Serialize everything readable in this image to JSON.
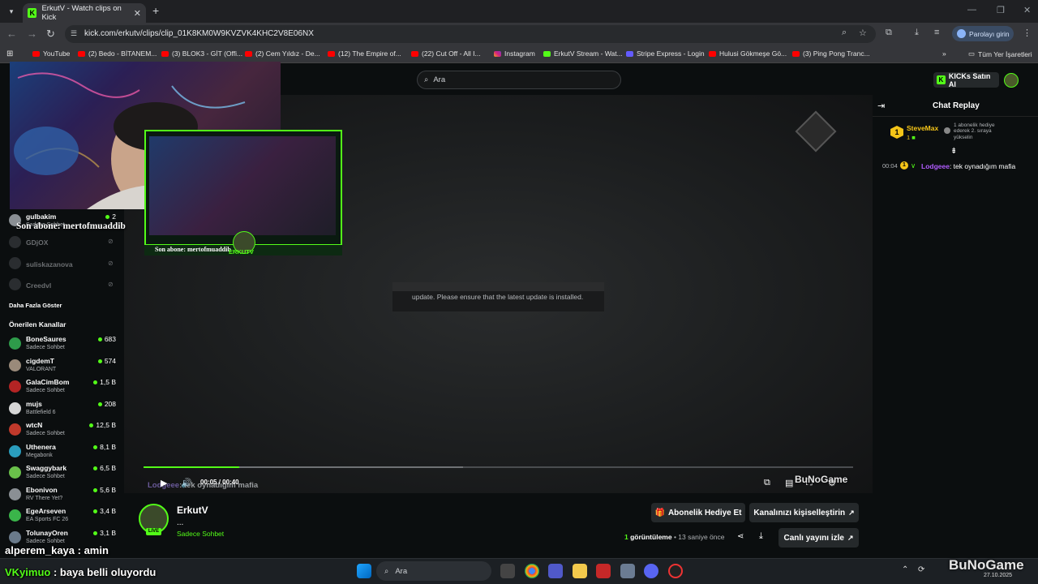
{
  "browser": {
    "tab_title": "ErkutV - Watch clips on Kick",
    "tab_favicon": "K",
    "new_tab": "+",
    "url": "kick.com/erkutv/clips/clip_01K8KM0W9KVZVK4KHC2V8E06NX",
    "signin_label": "Parolayı girin",
    "bookmarks": [
      "YouTube",
      "(2) Bedo - BİTANEM...",
      "(3) BLOK3 - GİT (Offi...",
      "(2) Cem Yıldız - De...",
      "(12) The Empire of...",
      "(22) Cut Off - All I...",
      "Instagram",
      "ErkutV Stream - Wat...",
      "Stripe Express - Login",
      "Hulusi Gökmeşe Gö...",
      "(3) Ping Pong Tranc..."
    ],
    "bookmarks_more": "»",
    "all_bookmarks": "Tüm Yer İşaretleri"
  },
  "kick": {
    "search_placeholder": "Ara",
    "kicks_button": "KICKs Satın Al",
    "kicks_icon": "K"
  },
  "sidebar": {
    "following": [
      {
        "name": "gulbakim",
        "sub": "Sadece Sohbet",
        "count": "2",
        "live": true
      },
      {
        "name": "GDjOX",
        "sub": "",
        "count": "",
        "live": false
      },
      {
        "name": "suliskazanova",
        "sub": "",
        "count": "",
        "live": false
      },
      {
        "name": "Creedvl",
        "sub": "",
        "count": "",
        "live": false
      }
    ],
    "show_more": "Daha Fazla Göster",
    "recommended_title": "Önerilen Kanallar",
    "recommended": [
      {
        "name": "BoneSaures",
        "sub": "Sadece Sohbet",
        "count": "683",
        "color": "#2e9b4a"
      },
      {
        "name": "cigdemT",
        "sub": "VALORANT",
        "count": "574",
        "color": "#9a8a7a"
      },
      {
        "name": "GalaCimBom",
        "sub": "Sadece Sohbet",
        "count": "1,5 B",
        "color": "#b32424"
      },
      {
        "name": "mujs",
        "sub": "Battlefield 6",
        "count": "208",
        "color": "#d7d7d7"
      },
      {
        "name": "wtcN",
        "sub": "Sadece Sohbet",
        "count": "12,5 B",
        "color": "#c0392b"
      },
      {
        "name": "Uthenera",
        "sub": "Megabonk",
        "count": "8,1 B",
        "color": "#2a9dbd"
      },
      {
        "name": "Swaggybark",
        "sub": "Sadece Sohbet",
        "count": "6,5 B",
        "color": "#6ac04a"
      },
      {
        "name": "Ebonivon",
        "sub": "RV There Yet?",
        "count": "5,6 B",
        "color": "#8a8f94"
      },
      {
        "name": "EgeArseven",
        "sub": "EA Sports FC 26",
        "count": "3,4 B",
        "color": "#3ab54a"
      },
      {
        "name": "TolunayOren",
        "sub": "Sadece Sohbet",
        "count": "3,1 B",
        "color": "#6a7a8a"
      }
    ]
  },
  "video": {
    "message": "update. Please ensure that the latest update is installed.",
    "time_current": "00:05",
    "time_sep": "/",
    "time_total": "00:40",
    "progress": 0.135,
    "buffered": 0.45,
    "ghost_chat_user": "Lodgeee",
    "ghost_chat_text": ": tek oynadığım mafia",
    "watermark": "BuNoGame",
    "cam_overlay": "Son abone: mertofmuaddib",
    "cam_overlay_small": "Son abone: mertofmuaddib",
    "cam_badge": "ERKUTV"
  },
  "clip": {
    "streamer": "ErkutV",
    "title": "...",
    "category": "Sadece Sohbet",
    "live_badge": "LIVE",
    "gift_button": "Abonelik Hediye Et",
    "customize_button": "Kanalınızı kişiselleştirin",
    "views_count": "1",
    "views_label": "görüntüleme",
    "ago": "• 13 saniye önce",
    "watch_live_button": "Canlı yayını izle"
  },
  "chat": {
    "title": "Chat Replay",
    "pinned_user": "SteveMax",
    "pinned_rank": "1",
    "pinned_count": "1",
    "pinned_text": "1 abonelik hediye ederek 2. sıraya yükselin",
    "messages": [
      {
        "time": "00:04",
        "user": "Lodgeee",
        "text": ": tek oynadığım mafia"
      }
    ]
  },
  "overlay_chat": [
    {
      "user": "alperem_kaya",
      "text": ": amin"
    },
    {
      "user": "Kyimuo",
      "text": ": baya belli oluyordu"
    }
  ],
  "taskbar": {
    "search_placeholder": "Ara",
    "date": "27.10.2025",
    "watermark": "BuNoGame"
  },
  "colors": {
    "kick_green": "#53fc18",
    "background": "#0b0e0f",
    "username_purple": "#b15cff",
    "gold": "#f5c518"
  }
}
